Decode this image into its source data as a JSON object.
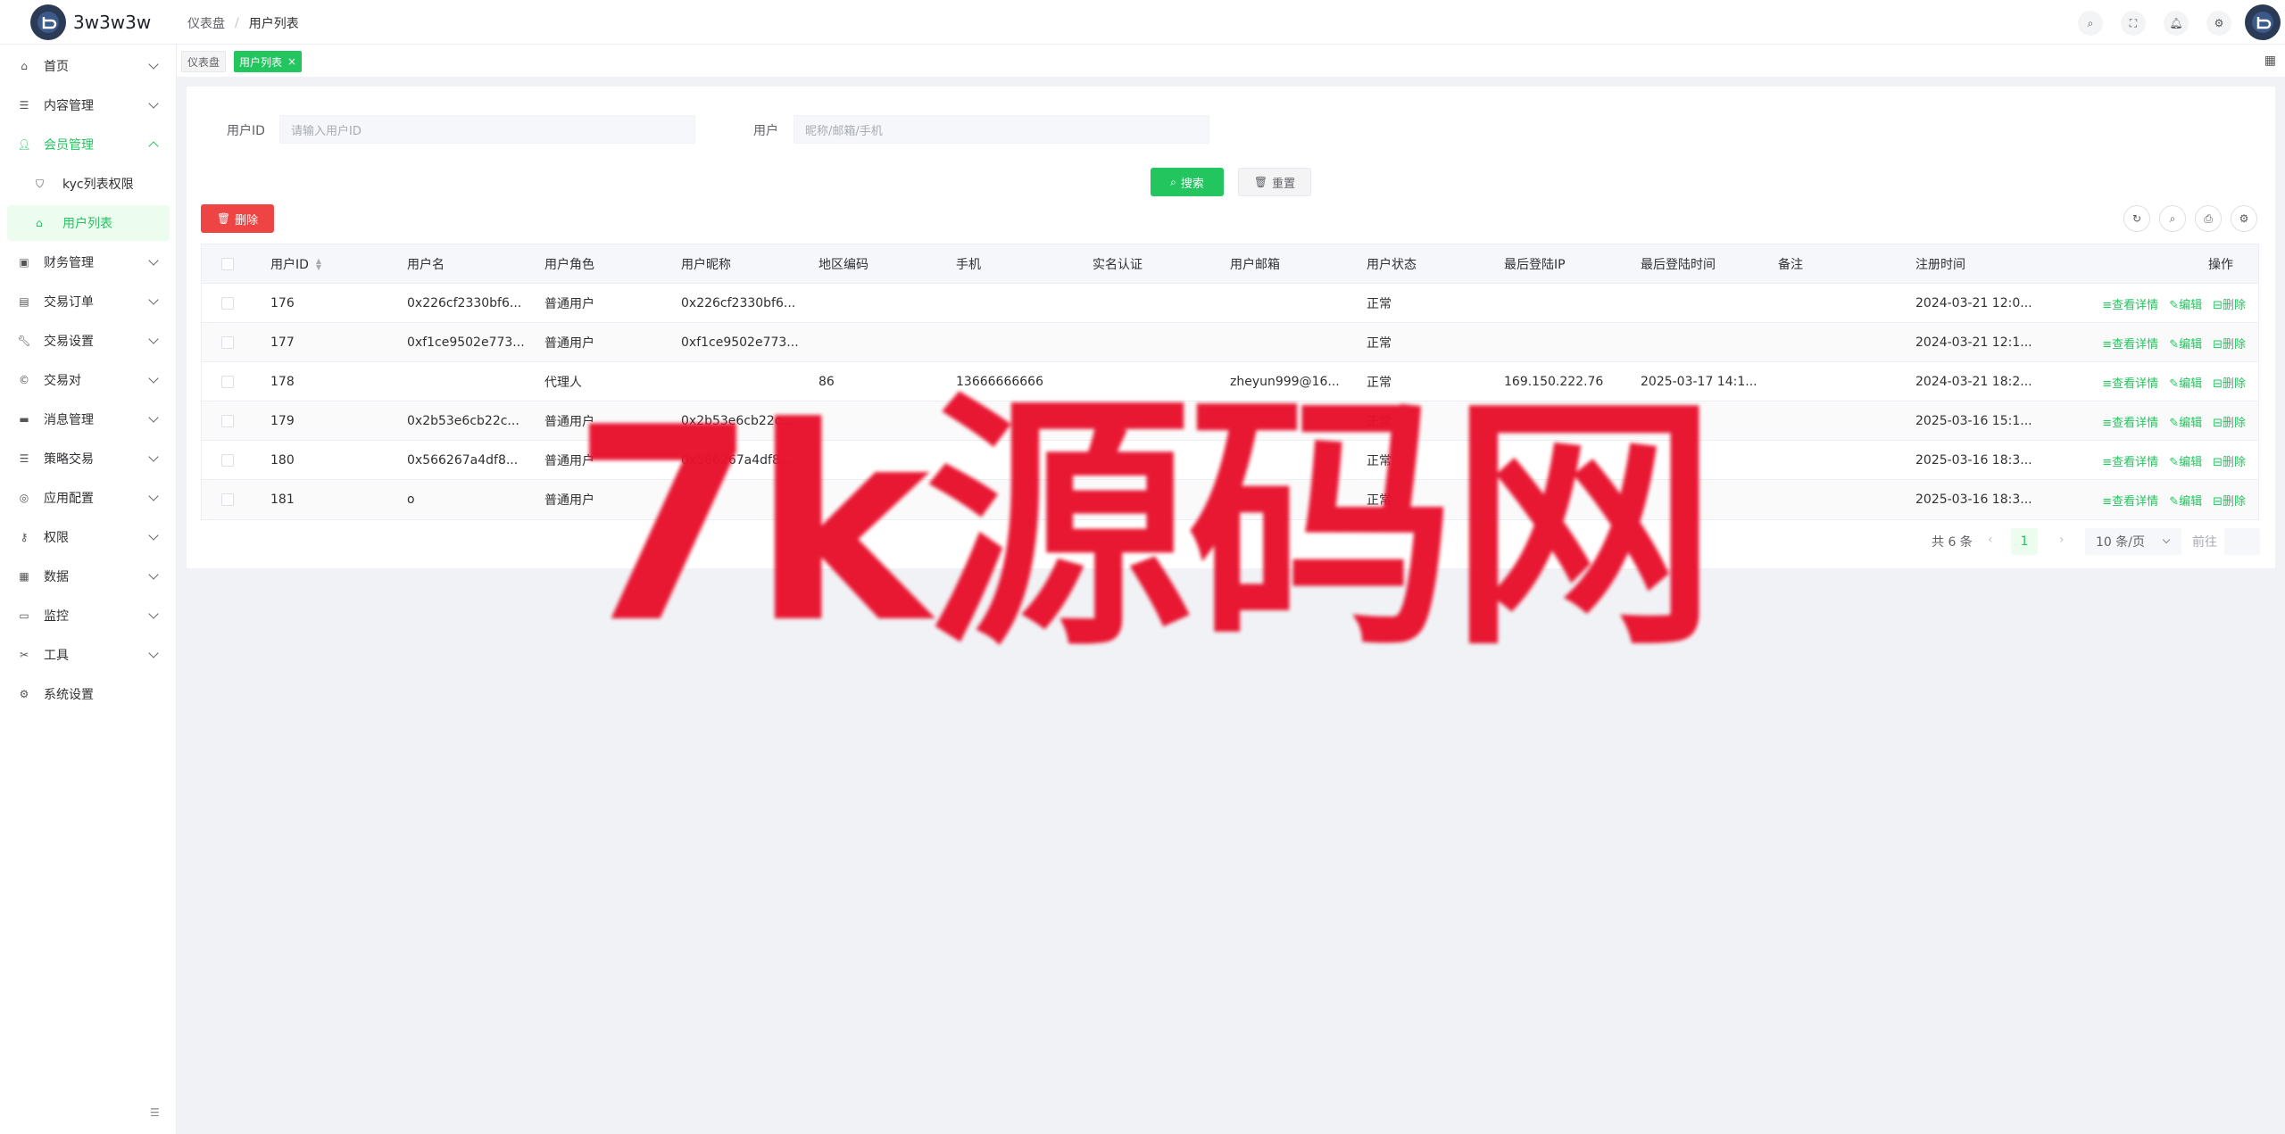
{
  "app": {
    "logo_text": "3w3w3w"
  },
  "header": {
    "breadcrumb": {
      "home": "仪表盘",
      "separator": "/",
      "current": "用户列表"
    },
    "icons": [
      "search-icon",
      "fullscreen-icon",
      "bell-icon",
      "gear-icon"
    ]
  },
  "sidebar": {
    "items": [
      {
        "label": "首页",
        "icon": "home-icon"
      },
      {
        "label": "内容管理",
        "icon": "list-icon"
      },
      {
        "label": "会员管理",
        "icon": "user-icon"
      },
      {
        "label": "kyc列表权限",
        "icon": "shield-icon"
      },
      {
        "label": "用户列表",
        "icon": "home-icon"
      },
      {
        "label": "财务管理",
        "icon": "wallet-icon"
      },
      {
        "label": "交易订单",
        "icon": "table-icon"
      },
      {
        "label": "交易设置",
        "icon": "wrench-icon"
      },
      {
        "label": "交易对",
        "icon": "currency-icon"
      },
      {
        "label": "消息管理",
        "icon": "message-icon"
      },
      {
        "label": "策略交易",
        "icon": "list-icon"
      },
      {
        "label": "应用配置",
        "icon": "app-config-icon"
      },
      {
        "label": "权限",
        "icon": "key-user-icon"
      },
      {
        "label": "数据",
        "icon": "data-icon"
      },
      {
        "label": "监控",
        "icon": "monitor-icon"
      },
      {
        "label": "工具",
        "icon": "tools-icon"
      },
      {
        "label": "系统设置",
        "icon": "gear-icon"
      }
    ]
  },
  "tags": {
    "dashboard": "仪表盘",
    "users": "用户列表",
    "close": "×"
  },
  "search": {
    "user_id_label": "用户ID",
    "user_id_placeholder": "请输入用户ID",
    "user_label": "用户",
    "user_placeholder": "昵称/邮箱/手机",
    "search_button": "搜索",
    "reset_button": "重置"
  },
  "toolbar": {
    "delete_button": "删除"
  },
  "table": {
    "headers": [
      "用户ID",
      "用户名",
      "用户角色",
      "用户昵称",
      "地区编码",
      "手机",
      "实名认证",
      "用户邮箱",
      "用户状态",
      "最后登陆IP",
      "最后登陆时间",
      "备注",
      "注册时间",
      "操作"
    ],
    "rows": [
      [
        "176",
        "0x226cf2330bf6...",
        "普通用户",
        "0x226cf2330bf6...",
        "",
        "",
        "",
        "",
        "正常",
        "",
        "",
        "",
        "2024-03-21 12:0..."
      ],
      [
        "177",
        "0xf1ce9502e773...",
        "普通用户",
        "0xf1ce9502e773...",
        "",
        "",
        "",
        "",
        "正常",
        "",
        "",
        "",
        "2024-03-21 12:1..."
      ],
      [
        "178",
        "",
        "代理人",
        "",
        "86",
        "13666666666",
        "",
        "zheyun999@16...",
        "正常",
        "169.150.222.76",
        "2025-03-17 14:1...",
        "",
        "2024-03-21 18:2..."
      ],
      [
        "179",
        "0x2b53e6cb22c...",
        "普通用户",
        "0x2b53e6cb22c...",
        "",
        "",
        "",
        "",
        "正常",
        "",
        "",
        "",
        "2025-03-16 15:1..."
      ],
      [
        "180",
        "0x566267a4df8...",
        "普通用户",
        "0x566267a4df8...",
        "",
        "",
        "",
        "",
        "正常",
        "",
        "",
        "",
        "2025-03-16 18:3..."
      ],
      [
        "181",
        "o",
        "普通用户",
        "",
        "",
        "",
        "",
        "",
        "正常",
        "",
        "",
        "",
        "2025-03-16 18:3..."
      ]
    ],
    "ops": {
      "view": "≡查看详情",
      "edit": "✎编辑",
      "delete": "⊟删除"
    }
  },
  "pagination": {
    "total": "共 6 条",
    "prev": "‹",
    "page": "1",
    "next": "›",
    "page_size": "10 条/页",
    "goto": "前往"
  },
  "watermark": "7k源码网"
}
